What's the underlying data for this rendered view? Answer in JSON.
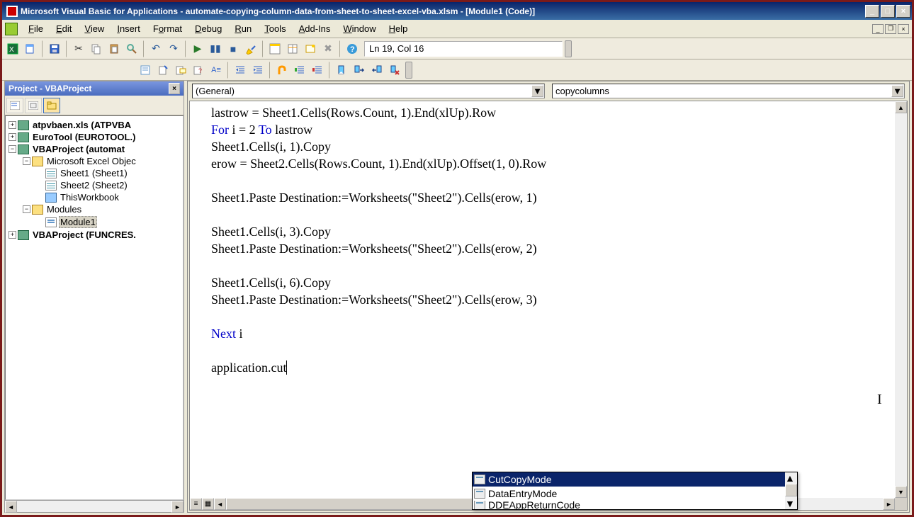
{
  "title": "Microsoft Visual Basic for Applications - automate-copying-column-data-from-sheet-to-sheet-excel-vba.xlsm - [Module1 (Code)]",
  "menus": [
    "File",
    "Edit",
    "View",
    "Insert",
    "Format",
    "Debug",
    "Run",
    "Tools",
    "Add-Ins",
    "Window",
    "Help"
  ],
  "cursor_pos": "Ln 19, Col 16",
  "project_panel_title": "Project - VBAProject",
  "tree": {
    "n0": "atpvbaen.xls (ATPVBA",
    "n1": "EuroTool (EUROTOOL.)",
    "n2": "VBAProject (automat",
    "n2a": "Microsoft Excel Objec",
    "n2a1": "Sheet1 (Sheet1)",
    "n2a2": "Sheet2 (Sheet2)",
    "n2a3": "ThisWorkbook",
    "n2b": "Modules",
    "n2b1": "Module1",
    "n3": "VBAProject (FUNCRES."
  },
  "dd_left": "(General)",
  "dd_right": "copycolumns",
  "code": {
    "l1a": "lastrow = Sheet1.Cells(Rows.Count, 1).End(xlUp).Row",
    "l2a": "For",
    "l2b": " i = 2 ",
    "l2c": "To",
    "l2d": " lastrow",
    "l3": "Sheet1.Cells(i, 1).Copy",
    "l4": "erow = Sheet2.Cells(Rows.Count, 1).End(xlUp).Offset(1, 0).Row",
    "l6": "Sheet1.Paste Destination:=Worksheets(\"Sheet2\").Cells(erow, 1)",
    "l8": "Sheet1.Cells(i, 3).Copy",
    "l9": "Sheet1.Paste Destination:=Worksheets(\"Sheet2\").Cells(erow, 2)",
    "l11": "Sheet1.Cells(i, 6).Copy",
    "l12": "Sheet1.Paste Destination:=Worksheets(\"Sheet2\").Cells(erow, 3)",
    "l14a": "Next",
    "l14b": " i",
    "l16": "application.cut"
  },
  "intellisense": {
    "i0": "CutCopyMode",
    "i1": "DataEntryMode",
    "i2": "DDEAppReturnCode"
  }
}
